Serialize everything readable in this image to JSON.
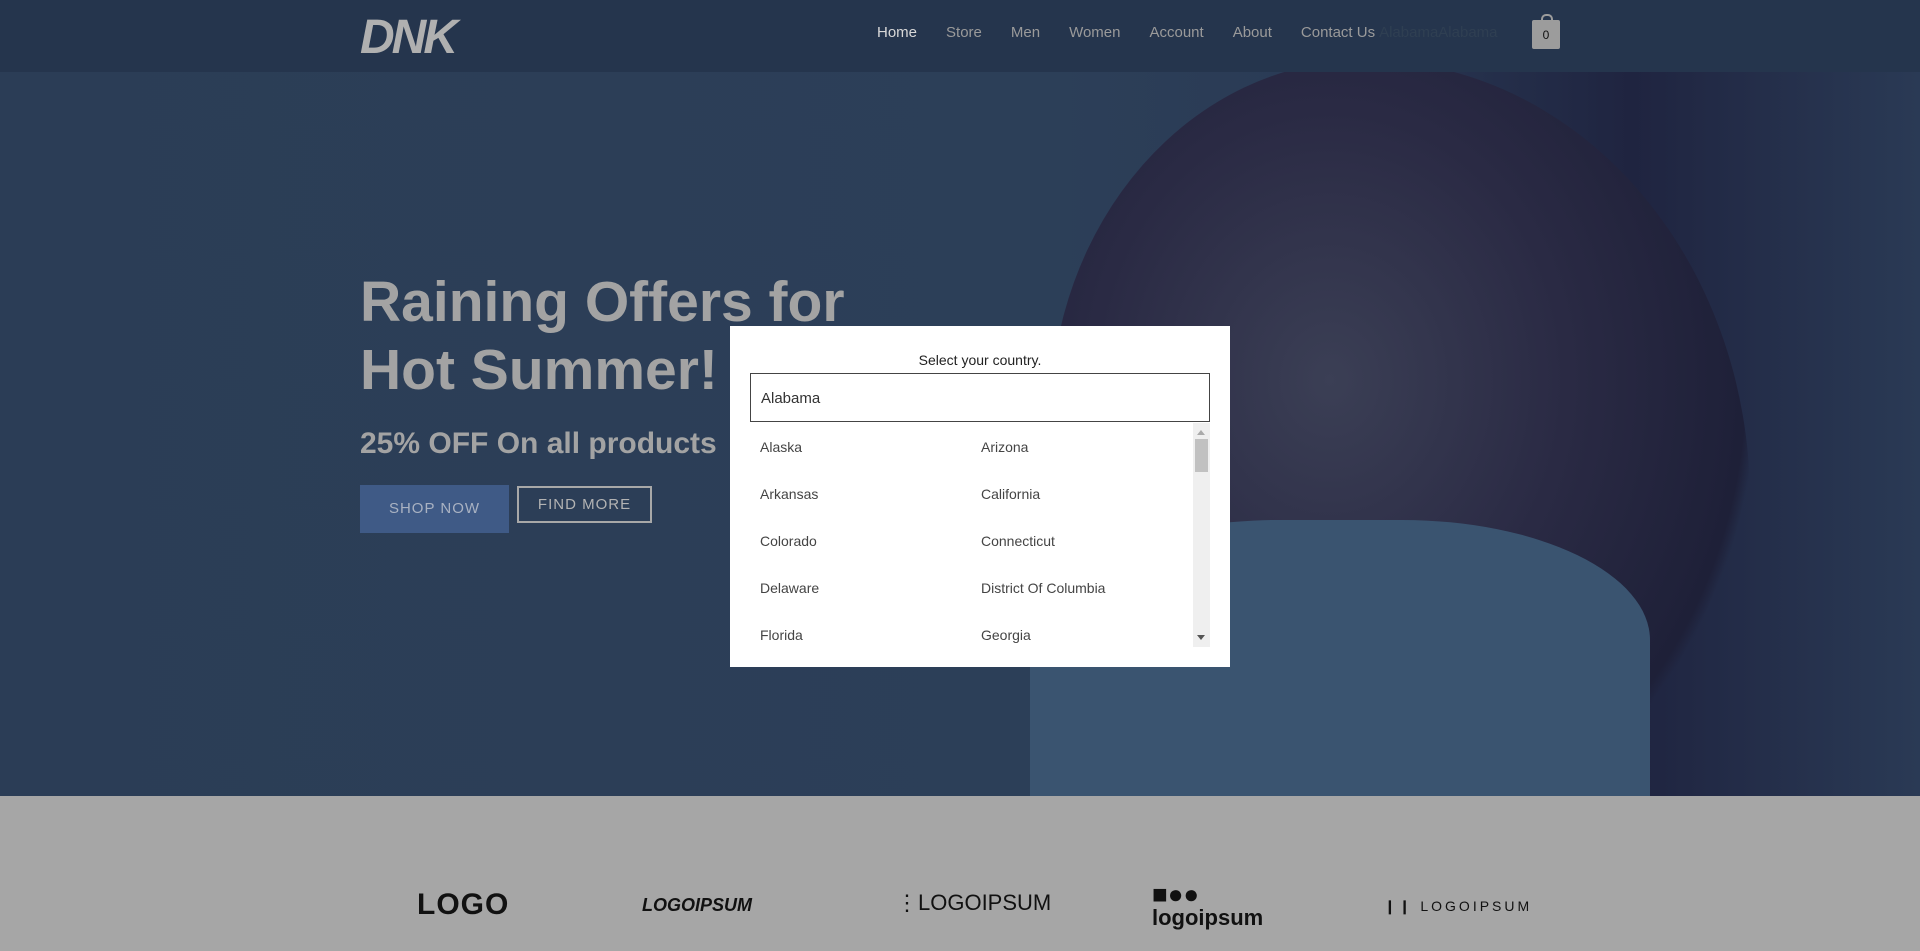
{
  "header": {
    "logo": "DNK",
    "nav": [
      "Home",
      "Store",
      "Men",
      "Women",
      "Account",
      "About",
      "Contact Us"
    ],
    "nav_extra": "AlabamaAlabama",
    "cart_count": "0"
  },
  "hero": {
    "title_line1": "Raining Offers for",
    "title_line2": "Hot Summer!",
    "subtitle": "25% OFF On all products",
    "shop_now": "SHOP NOW",
    "find_more": "FIND MORE"
  },
  "modal": {
    "title": "Select your country.",
    "input_value": "Alabama",
    "options": [
      [
        "Alaska",
        "Arizona"
      ],
      [
        "Arkansas",
        "California"
      ],
      [
        "Colorado",
        "Connecticut"
      ],
      [
        "Delaware",
        "District Of Columbia"
      ],
      [
        "Florida",
        "Georgia"
      ]
    ]
  },
  "logos": [
    "LOGO",
    "LOGOIPSUM",
    "LOGOIPSUM",
    "logoipsum",
    "LOGOIPSUM"
  ]
}
